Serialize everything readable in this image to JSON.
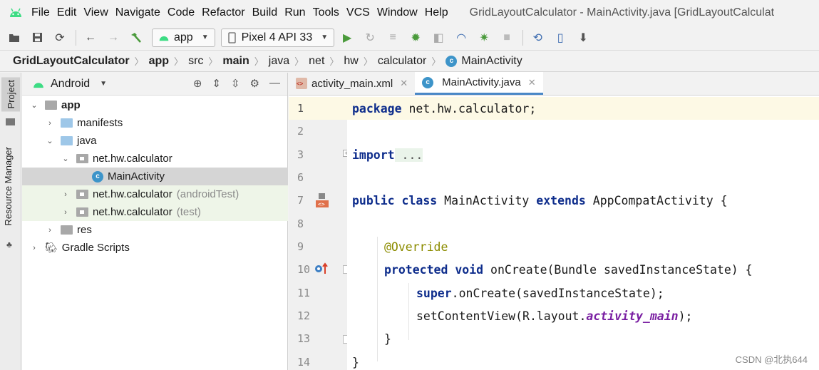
{
  "menu": {
    "items": [
      "File",
      "Edit",
      "View",
      "Navigate",
      "Code",
      "Refactor",
      "Build",
      "Run",
      "Tools",
      "VCS",
      "Window",
      "Help"
    ],
    "window_title": "GridLayoutCalculator - MainActivity.java [GridLayoutCalculat"
  },
  "toolbar": {
    "run_config": "app",
    "device": "Pixel 4 API 33"
  },
  "breadcrumb": {
    "items": [
      "GridLayoutCalculator",
      "app",
      "src",
      "main",
      "java",
      "net",
      "hw",
      "calculator",
      "MainActivity"
    ]
  },
  "side_tabs": {
    "project": "Project",
    "resource_manager": "Resource Manager"
  },
  "project_panel": {
    "view_selector": "Android",
    "tree": [
      {
        "label": "app",
        "suffix": ""
      },
      {
        "label": "manifests",
        "suffix": ""
      },
      {
        "label": "java",
        "suffix": ""
      },
      {
        "label": "net.hw.calculator",
        "suffix": ""
      },
      {
        "label": "MainActivity",
        "suffix": ""
      },
      {
        "label": "net.hw.calculator",
        "suffix": "(androidTest)"
      },
      {
        "label": "net.hw.calculator",
        "suffix": "(test)"
      },
      {
        "label": "res",
        "suffix": ""
      },
      {
        "label": "Gradle Scripts",
        "suffix": ""
      }
    ]
  },
  "editor": {
    "tabs": [
      {
        "label": "activity_main.xml"
      },
      {
        "label": "MainActivity.java"
      }
    ],
    "line_numbers": [
      "1",
      "2",
      "3",
      "6",
      "7",
      "8",
      "9",
      "10",
      "11",
      "12",
      "13",
      "14"
    ],
    "code": {
      "l1_kw": "package",
      "l1_rest": " net.hw.calculator;",
      "l3_kw": "import",
      "l3_fold": " ...",
      "l7_kw1": "public",
      "l7_kw2": "class",
      "l7_name": " MainActivity ",
      "l7_kw3": "extends",
      "l7_rest": " AppCompatActivity {",
      "l9_ann": "@Override",
      "l10_kw1": "protected",
      "l10_kw2": "void",
      "l10_rest": " onCreate(Bundle savedInstanceState) {",
      "l11_kw": "super",
      "l11_rest": ".onCreate(savedInstanceState);",
      "l12_pre": "setContentView(R.layout.",
      "l12_field": "activity_main",
      "l12_post": ");",
      "l13": "}",
      "l14": "}"
    }
  },
  "watermark": "CSDN @北执644",
  "colors": {
    "keyword": "#0e2d8c",
    "annotation": "#8c8c00",
    "field": "#7a1fa2",
    "active_tab": "#4a88c7"
  },
  "icons": [
    "android-logo-icon",
    "open-icon",
    "save-icon",
    "sync-icon",
    "back-icon",
    "forward-icon",
    "build-hammer-icon",
    "device-icon",
    "run-icon",
    "apply-changes-icon",
    "debug-icon",
    "profile-icon",
    "attach-debugger-icon",
    "stop-icon",
    "gradle-sync-icon",
    "avd-manager-icon",
    "sdk-manager-icon",
    "locate-icon",
    "collapse-icon",
    "expand-icon",
    "settings-icon",
    "minimize-icon",
    "class-icon",
    "gradle-elephant-icon"
  ]
}
